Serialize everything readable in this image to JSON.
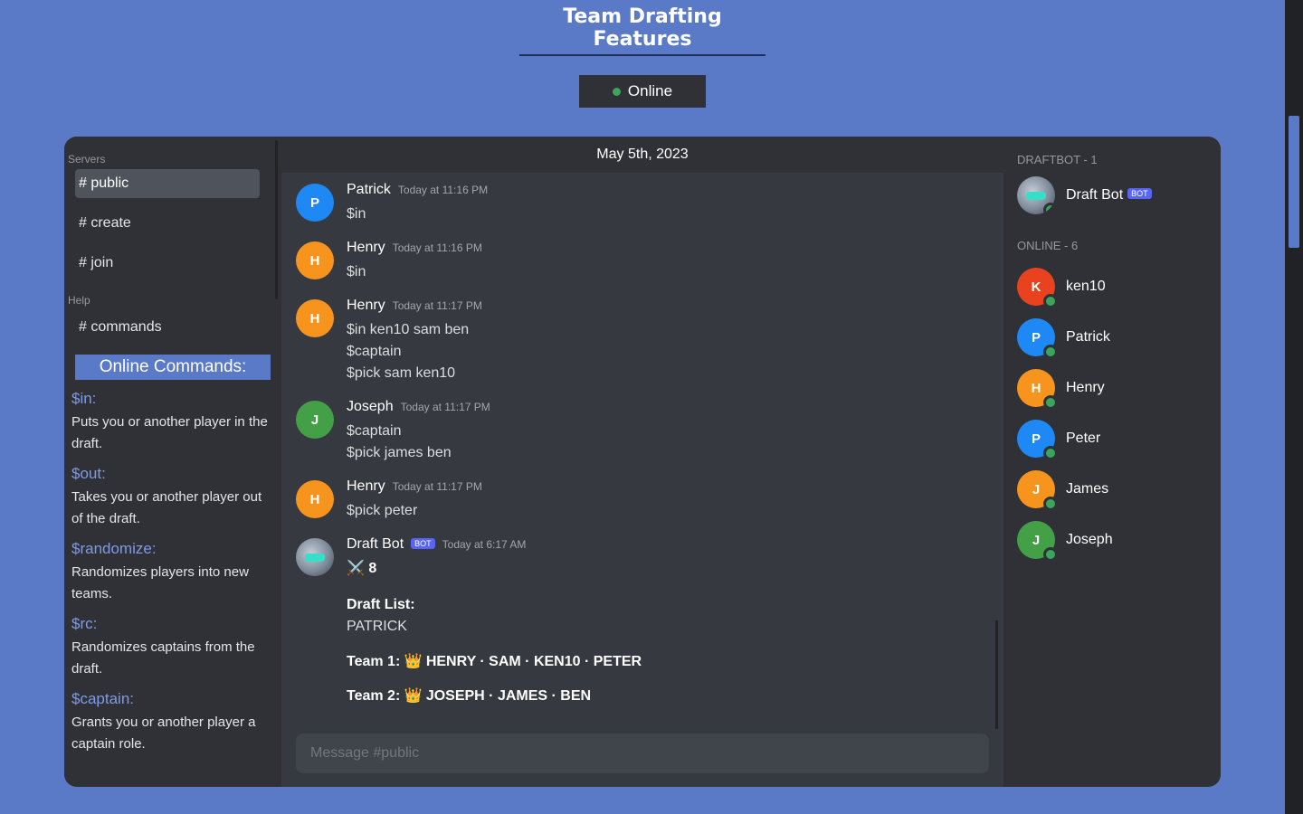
{
  "page": {
    "title": "Team Drafting Features"
  },
  "status": {
    "label": "Online",
    "color": "#3ba55c"
  },
  "sidebar": {
    "servers_label": "Servers",
    "channels": [
      {
        "label": "# public",
        "active": true
      },
      {
        "label": "# create",
        "active": false
      },
      {
        "label": "# join",
        "active": false
      }
    ],
    "help_label": "Help",
    "help_channels": [
      {
        "label": "# commands"
      }
    ],
    "commands_header": "Online Commands:",
    "commands": [
      {
        "name": "$in:",
        "desc": "Puts you or another player in the draft."
      },
      {
        "name": "$out:",
        "desc": "Takes you or another player out of the draft."
      },
      {
        "name": "$randomize:",
        "desc": "Randomizes players into new teams."
      },
      {
        "name": "$rc:",
        "desc": "Randomizes captains from the draft."
      },
      {
        "name": "$captain:",
        "desc": "Grants you or another player a captain role."
      }
    ]
  },
  "chat": {
    "date": "May 5th, 2023",
    "messages": [
      {
        "author": "Patrick",
        "initial": "P",
        "color": "#1e88f5",
        "time": "Today at 11:16 PM",
        "lines": [
          "$in"
        ]
      },
      {
        "author": "Henry",
        "initial": "H",
        "color": "#f7941d",
        "time": "Today at 11:16 PM",
        "lines": [
          "$in"
        ]
      },
      {
        "author": "Henry",
        "initial": "H",
        "color": "#f7941d",
        "time": "Today at 11:17 PM",
        "lines": [
          "$in ken10 sam ben",
          "$captain",
          "$pick sam ken10"
        ]
      },
      {
        "author": "Joseph",
        "initial": "J",
        "color": "#43a047",
        "time": "Today at 11:17 PM",
        "lines": [
          "$captain",
          "$pick james ben"
        ]
      },
      {
        "author": "Henry",
        "initial": "H",
        "color": "#f7941d",
        "time": "Today at 11:17 PM",
        "lines": [
          "$pick peter"
        ]
      }
    ],
    "bot_message": {
      "author": "Draft Bot",
      "tag": "BOT",
      "time": "Today at 6:17 AM",
      "count_line": "⚔️ 8",
      "list_title": "Draft List:",
      "list_entries": "PATRICK",
      "team1_label": "Team 1:",
      "team1_members": "👑 HENRY · SAM · KEN10 · PETER",
      "team2_label": "Team 2:",
      "team2_members": "👑 JOSEPH · JAMES · BEN"
    },
    "composer_placeholder": "Message #public"
  },
  "members": {
    "bot_group_label": "DRAFTBOT - 1",
    "bot": {
      "name": "Draft Bot",
      "tag": "BOT"
    },
    "online_group_label": "ONLINE - 6",
    "online": [
      {
        "name": "ken10",
        "initial": "K",
        "color": "#e8421f"
      },
      {
        "name": "Patrick",
        "initial": "P",
        "color": "#1e88f5"
      },
      {
        "name": "Henry",
        "initial": "H",
        "color": "#f7941d"
      },
      {
        "name": "Peter",
        "initial": "P",
        "color": "#1e88f5"
      },
      {
        "name": "James",
        "initial": "J",
        "color": "#f7941d"
      },
      {
        "name": "Joseph",
        "initial": "J",
        "color": "#43a047"
      }
    ]
  }
}
